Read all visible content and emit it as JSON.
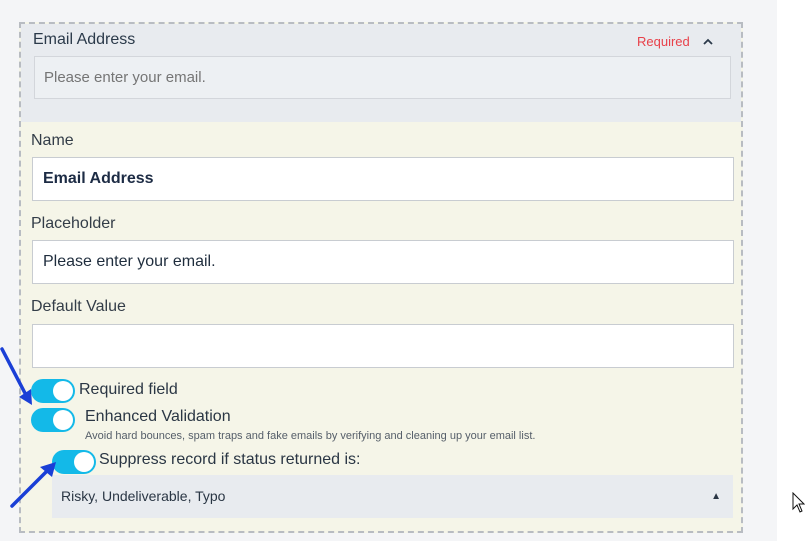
{
  "field": {
    "header_title": "Email Address",
    "required_tag": "Required",
    "collapse_icon": "chevron-up-icon",
    "preview_placeholder": "Please enter your email."
  },
  "form": {
    "name_label": "Name",
    "name_value": "Email Address",
    "placeholder_label": "Placeholder",
    "placeholder_value": "Please enter your email.",
    "default_label": "Default Value",
    "default_value": ""
  },
  "toggles": {
    "required": {
      "label": "Required field",
      "on": true
    },
    "enhanced": {
      "label": "Enhanced Validation",
      "on": true,
      "helper": "Avoid hard bounces, spam traps and fake emails by verifying and cleaning up your email list."
    },
    "suppress": {
      "label": "Suppress record if status returned is:",
      "on": true
    }
  },
  "suppress_select": {
    "value": "Risky, Undeliverable, Typo"
  },
  "colors": {
    "toggle_on": "#13b9e8",
    "required": "#e8414a",
    "arrow": "#1a3fd6"
  }
}
